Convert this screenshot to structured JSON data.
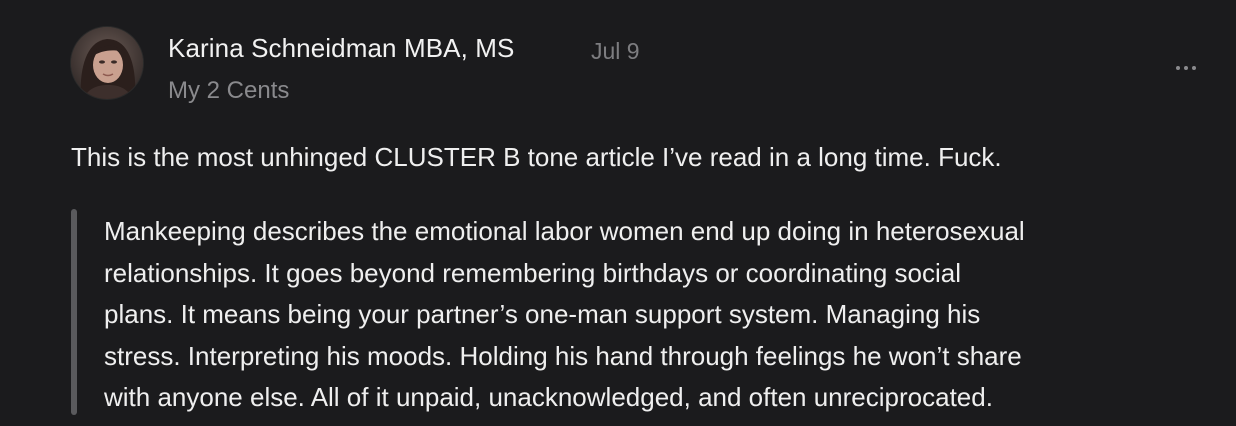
{
  "comment": {
    "author": {
      "name": "Karina Schneidman MBA, MS",
      "date": "Jul 9",
      "publication": "My 2 Cents",
      "avatar_icon": "avatar-photo"
    },
    "more_icon": "ellipsis-icon",
    "text": "This is the most unhinged CLUSTER B tone article I’ve read in a long time. Fuck.",
    "quote": {
      "lines": [
        "Mankeeping describes the emotional labor women end up doing in heterosexual",
        "relationships. It goes beyond remembering birthdays or coordinating social",
        "plans. It means being your partner’s one-man support system. Managing his",
        "stress. Interpreting his moods. Holding his hand through feelings he won’t share",
        "with anyone else. All of it unpaid, unacknowledged, and often unreciprocated."
      ]
    }
  },
  "colors": {
    "background": "#1b1b1d",
    "text_primary": "#efefef",
    "text_secondary": "#8a8a8d",
    "quote_bar": "#5a5a5d"
  }
}
